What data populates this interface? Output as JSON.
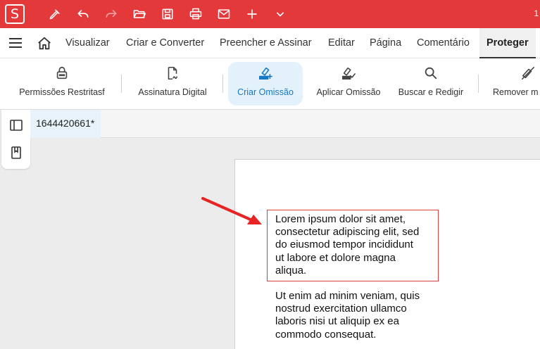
{
  "app": {
    "logo_letter": "S",
    "right_text": "1",
    "accent": "#e3393b"
  },
  "titlebar_icons": [
    "pen-icon",
    "undo-icon",
    "redo-icon",
    "open-folder-icon",
    "save-icon",
    "print-icon",
    "mail-icon",
    "add-icon",
    "chevron-down-icon"
  ],
  "menu": {
    "items": [
      "Visualizar",
      "Criar e Converter",
      "Preencher e Assinar",
      "Editar",
      "Página",
      "Comentário",
      "Proteger"
    ],
    "active": "Proteger"
  },
  "ribbon": {
    "buttons": [
      {
        "label": "Permissões Restritasf",
        "icon": "lock-icon"
      },
      {
        "label": "Assinatura Digital",
        "icon": "signed-document-icon"
      },
      {
        "label": "Criar Omissão",
        "icon": "redact-create-icon"
      },
      {
        "label": "Aplicar Omissão",
        "icon": "redact-apply-icon"
      },
      {
        "label": "Buscar e Redigir",
        "icon": "search-icon"
      },
      {
        "label": "Remover m",
        "icon": "remove-icon"
      }
    ],
    "active_color": "#1a78c2"
  },
  "document": {
    "tab_title": "1644420661*",
    "paragraph1": [
      "Lorem ipsum dolor sit amet,",
      "consectetur adipiscing elit, sed",
      "do eiusmod tempor incididunt",
      "ut labore et dolore magna",
      "aliqua."
    ],
    "paragraph2": [
      "Ut enim ad minim veniam, quis",
      "nostrud exercitation ullamco",
      "laboris nisi ut aliquip ex ea",
      "commodo consequat."
    ],
    "highlight_color": "#e03c3c"
  }
}
